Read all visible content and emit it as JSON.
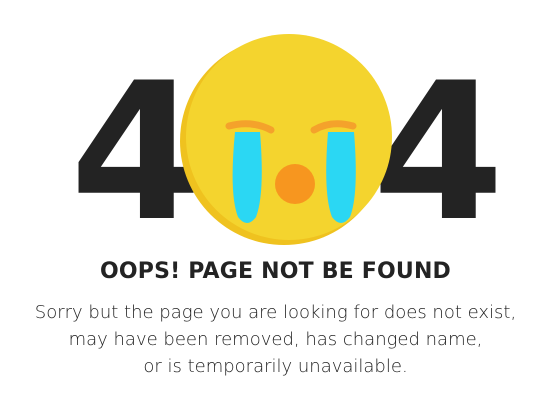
{
  "error": {
    "digit_left": "4",
    "digit_right": "4"
  },
  "heading": "OOPS! PAGE NOT BE FOUND",
  "message": {
    "lines": [
      "Sorry but the page you are looking for does not exist,",
      "may have been removed, has changed name,",
      "or is temporarily unavailable."
    ]
  },
  "colors": {
    "digit": "#232323",
    "face": "#f4d42e",
    "face_shadow": "#efc21f",
    "tears": "#2bd7f3",
    "brows": "#f4a22b",
    "mouth": "#f7961f"
  },
  "icons": {
    "middle_digit": "crying-face-icon"
  }
}
